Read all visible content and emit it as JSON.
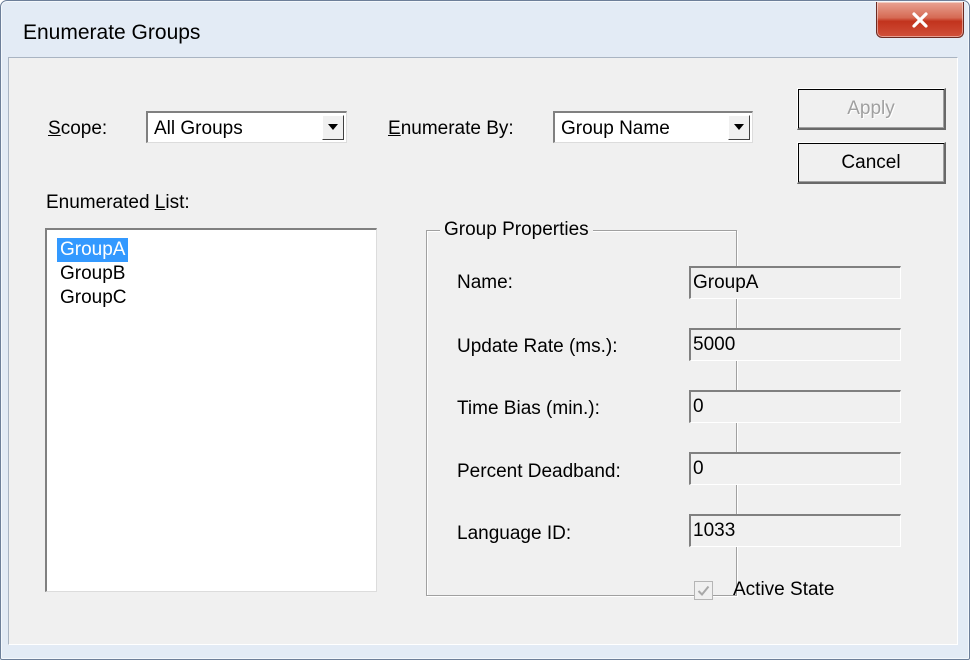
{
  "window": {
    "title": "Enumerate Groups",
    "close_icon": "close-x-icon"
  },
  "scope": {
    "label_accel": "S",
    "label_rest": "cope:",
    "value": "All Groups"
  },
  "enumerate_by": {
    "label_accel": "E",
    "label_rest": "numerate By:",
    "value": "Group Name"
  },
  "buttons": {
    "apply": "Apply",
    "cancel": "Cancel"
  },
  "list": {
    "label_pre": "Enumerated ",
    "label_accel": "L",
    "label_rest": "ist:",
    "items": [
      "GroupA",
      "GroupB",
      "GroupC"
    ],
    "selected": "GroupA"
  },
  "properties": {
    "title": "Group Properties",
    "name_label": "Name:",
    "name_value": "GroupA",
    "update_rate_label": "Update Rate (ms.):",
    "update_rate_value": "5000",
    "time_bias_label": "Time Bias (min.):",
    "time_bias_value": "0",
    "deadband_label": "Percent Deadband:",
    "deadband_value": "0",
    "language_label": "Language ID:",
    "language_value": "1033",
    "active_state_label": "Active State",
    "active_state_checked": true
  },
  "colors": {
    "selection": "#3399ff",
    "close_button": "#c7432b",
    "frame": "#e3ebf5"
  }
}
